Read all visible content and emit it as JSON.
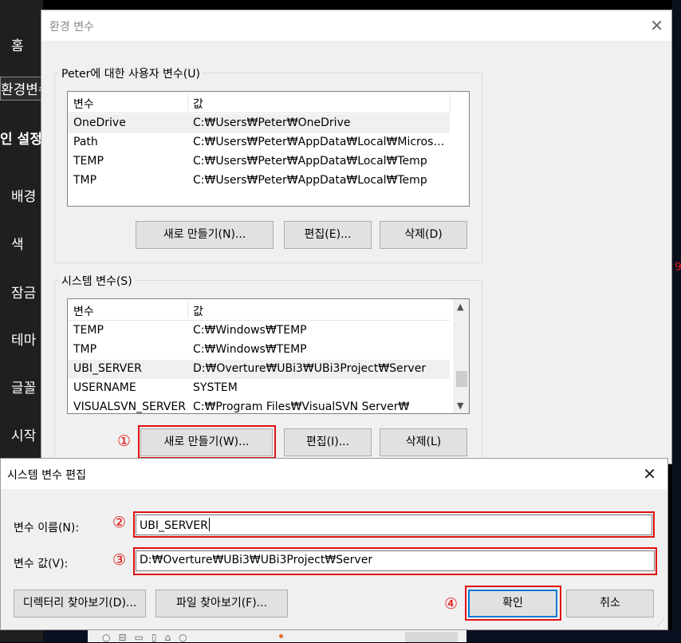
{
  "sidebar": {
    "items": [
      "홈",
      "환경변수",
      "인 설정",
      "배경",
      "색",
      "잠금",
      "테마",
      "글꼴",
      "시작"
    ]
  },
  "env_dialog": {
    "title": "환경 변수",
    "user_group_label": "Peter에 대한 사용자 변수(U)",
    "system_group_label": "시스템 변수(S)",
    "columns": [
      "변수",
      "값"
    ],
    "user_vars": [
      {
        "name": "OneDrive",
        "value": "C:₩Users₩Peter₩OneDrive"
      },
      {
        "name": "Path",
        "value": "C:₩Users₩Peter₩AppData₩Local₩Microsoft..."
      },
      {
        "name": "TEMP",
        "value": "C:₩Users₩Peter₩AppData₩Local₩Temp"
      },
      {
        "name": "TMP",
        "value": "C:₩Users₩Peter₩AppData₩Local₩Temp"
      }
    ],
    "system_vars": [
      {
        "name": "TEMP",
        "value": "C:₩Windows₩TEMP"
      },
      {
        "name": "TMP",
        "value": "C:₩Windows₩TEMP"
      },
      {
        "name": "UBI_SERVER",
        "value": "D:₩Overture₩UBi3₩UBi3Project₩Server"
      },
      {
        "name": "USERNAME",
        "value": "SYSTEM"
      },
      {
        "name": "VISUALSVN_SERVER",
        "value": "C:₩Program Files₩VisualSVN Server₩"
      }
    ],
    "user_buttons": {
      "new": "새로 만들기(N)...",
      "edit": "편집(E)...",
      "delete": "삭제(D)"
    },
    "system_buttons": {
      "new": "새로 만들기(W)...",
      "edit": "편집(I)...",
      "delete": "삭제(L)"
    }
  },
  "edit_dialog": {
    "title": "시스템 변수 편집",
    "name_label": "변수 이름(N):",
    "name_value": "UBI_SERVER",
    "value_label": "변수 값(V):",
    "value_value": "D:₩Overture₩UBi3₩UBi3Project₩Server",
    "browse_dir": "디렉터리 찾아보기(D)...",
    "browse_file": "파일 찾아보기(F)...",
    "ok": "확인",
    "cancel": "취소"
  },
  "annotations": {
    "step1": "①",
    "step2": "②",
    "step3": "③",
    "step4": "④",
    "color": "#e01010"
  },
  "icons": {
    "close": "close-icon",
    "scroll_up": "chevron-up-icon",
    "scroll_down": "chevron-down-icon"
  }
}
